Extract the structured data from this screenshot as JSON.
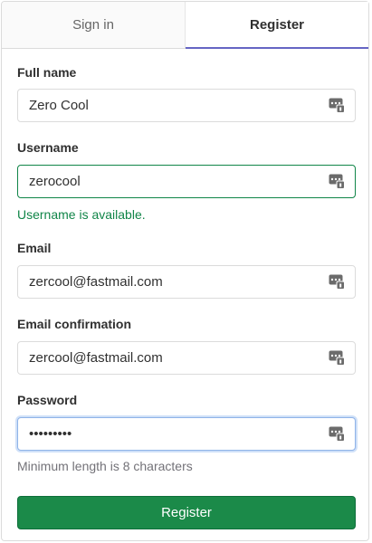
{
  "tabs": {
    "signin_label": "Sign in",
    "register_label": "Register"
  },
  "form": {
    "full_name": {
      "label": "Full name",
      "value": "Zero Cool"
    },
    "username": {
      "label": "Username",
      "value": "zerocool",
      "status": "Username is available."
    },
    "email": {
      "label": "Email",
      "value": "zercool@fastmail.com"
    },
    "email_confirmation": {
      "label": "Email confirmation",
      "value": "zercool@fastmail.com"
    },
    "password": {
      "label": "Password",
      "value": "zerocool1",
      "hint": "Minimum length is 8 characters"
    },
    "submit_label": "Register"
  },
  "icons": {
    "field_icon": "password-manager-icon"
  },
  "colors": {
    "accent": "#6666c4",
    "success": "#108548",
    "button": "#1b8a49",
    "focus": "#8fb3e8"
  }
}
